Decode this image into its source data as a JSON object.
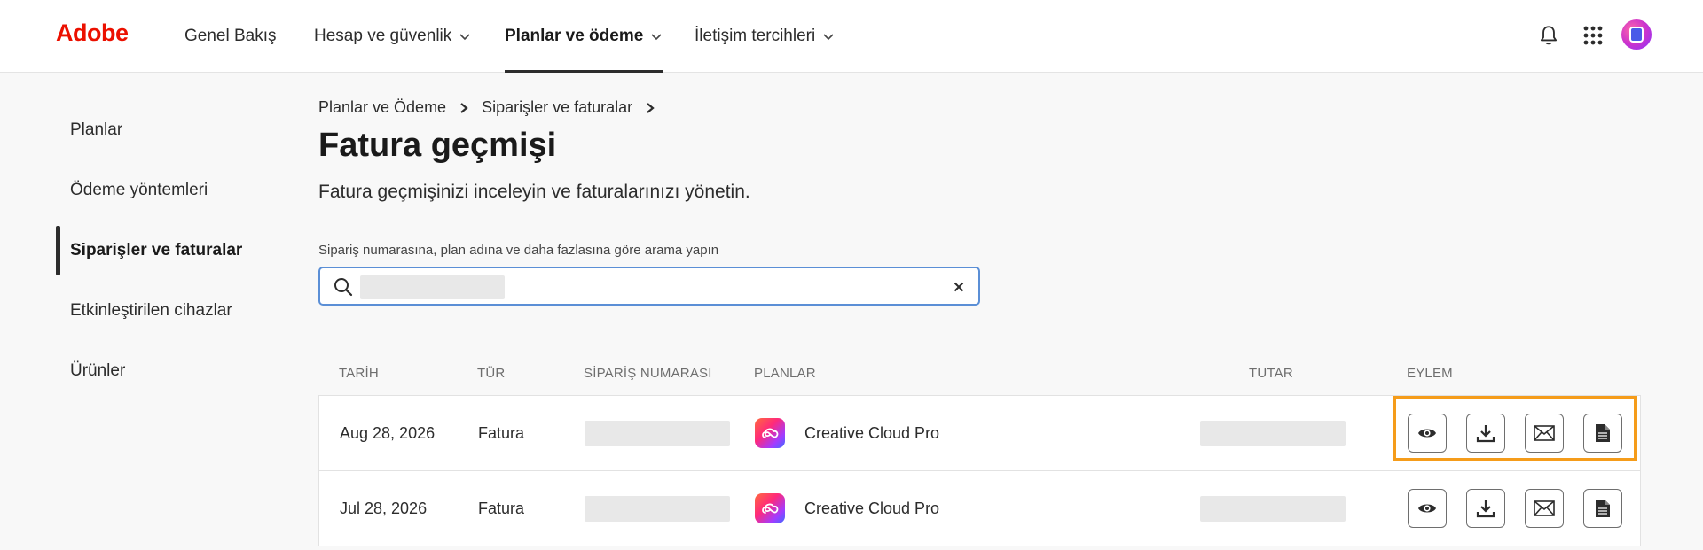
{
  "brand": {
    "logo_text": "Adobe",
    "logo_color": "#eb1000"
  },
  "nav": {
    "items": [
      {
        "label": "Genel Bakış",
        "has_dropdown": false,
        "active": false
      },
      {
        "label": "Hesap ve güvenlik",
        "has_dropdown": true,
        "active": false
      },
      {
        "label": "Planlar ve ödeme",
        "has_dropdown": true,
        "active": true
      },
      {
        "label": "İletişim tercihleri",
        "has_dropdown": true,
        "active": false
      }
    ],
    "icons": [
      "bell-icon",
      "app-grid-icon",
      "avatar"
    ]
  },
  "sidebar": {
    "items": [
      {
        "label": "Planlar",
        "active": false
      },
      {
        "label": "Ödeme yöntemleri",
        "active": false
      },
      {
        "label": "Siparişler ve faturalar",
        "active": true
      },
      {
        "label": "Etkinleştirilen cihazlar",
        "active": false
      },
      {
        "label": "Ürünler",
        "active": false
      }
    ]
  },
  "breadcrumb": [
    "Planlar ve Ödeme",
    "Siparişler ve faturalar"
  ],
  "page": {
    "title": "Fatura geçmişi",
    "description": "Fatura geçmişinizi inceleyin ve faturalarınızı yönetin."
  },
  "search": {
    "label": "Sipariş numarasına, plan adına ve daha fazlasına göre arama yapın",
    "value": "",
    "value_redacted": true,
    "placeholder": ""
  },
  "table": {
    "headers": {
      "date": "TARİH",
      "type": "TÜR",
      "order_number": "SİPARİŞ NUMARASI",
      "plans": "PLANLAR",
      "amount": "TUTAR",
      "action": "EYLEM"
    },
    "rows": [
      {
        "date": "Aug 28, 2026",
        "type": "Fatura",
        "order_number_redacted": true,
        "plan": "Creative Cloud Pro",
        "amount_redacted": true
      },
      {
        "date": "Jul 28, 2026",
        "type": "Fatura",
        "order_number_redacted": true,
        "plan": "Creative Cloud Pro",
        "amount_redacted": true
      }
    ],
    "actions": [
      "view-icon",
      "download-icon",
      "email-icon",
      "document-icon"
    ]
  },
  "highlight_color": "#f59c1a"
}
